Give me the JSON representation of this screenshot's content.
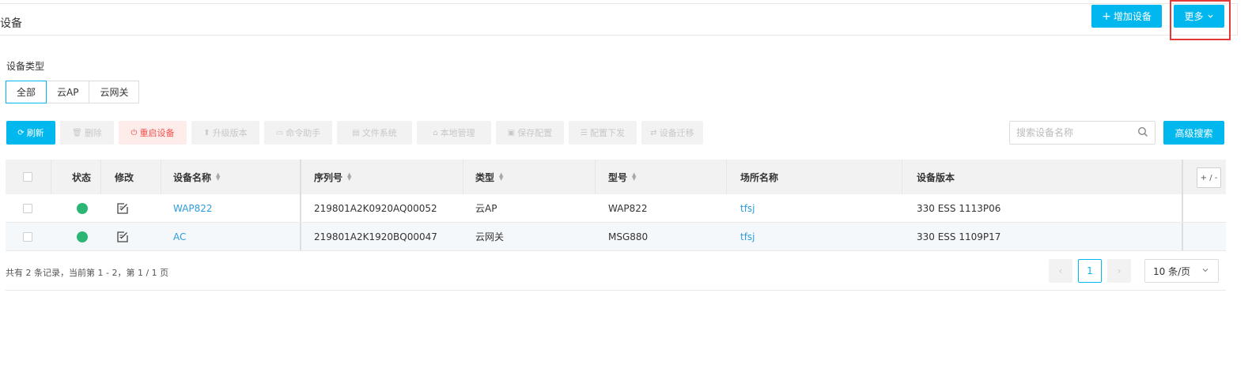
{
  "header": {
    "title": "设备",
    "add_button": "增加设备",
    "more_button": "更多"
  },
  "device_type": {
    "label": "设备类型",
    "tabs": [
      "全部",
      "云AP",
      "云网关"
    ],
    "active_index": 0
  },
  "toolbar": {
    "refresh": "刷新",
    "delete": "删除",
    "reboot": "重启设备",
    "upgrade": "升级版本",
    "command": "命令助手",
    "filesystem": "文件系统",
    "local_manage": "本地管理",
    "save_config": "保存配置",
    "deploy_config": "配置下发",
    "migrate": "设备迁移"
  },
  "search": {
    "placeholder": "搜索设备名称",
    "advanced_button": "高级搜索"
  },
  "table": {
    "columns": {
      "status": "状态",
      "edit": "修改",
      "name": "设备名称",
      "serial": "序列号",
      "type": "类型",
      "model": "型号",
      "site": "场所名称",
      "version": "设备版本"
    },
    "column_toggle": "+ / -",
    "rows": [
      {
        "status": "online",
        "name": "WAP822",
        "serial": "219801A2K0920AQ00052",
        "type": "云AP",
        "model": "WAP822",
        "site": "tfsj",
        "version": "330 ESS 1113P06"
      },
      {
        "status": "online",
        "name": "AC",
        "serial": "219801A2K1920BQ00047",
        "type": "云网关",
        "model": "MSG880",
        "site": "tfsj",
        "version": "330 ESS 1109P17"
      }
    ]
  },
  "footer": {
    "summary": "共有 2 条记录，当前第 1 - 2，第 1 / 1 页",
    "current_page": "1",
    "page_size": "10 条/页"
  },
  "colors": {
    "primary": "#00b7ee",
    "online": "#2bb673",
    "link": "#2d9cdb",
    "danger": "#ef5350",
    "highlight": "#e53935"
  }
}
